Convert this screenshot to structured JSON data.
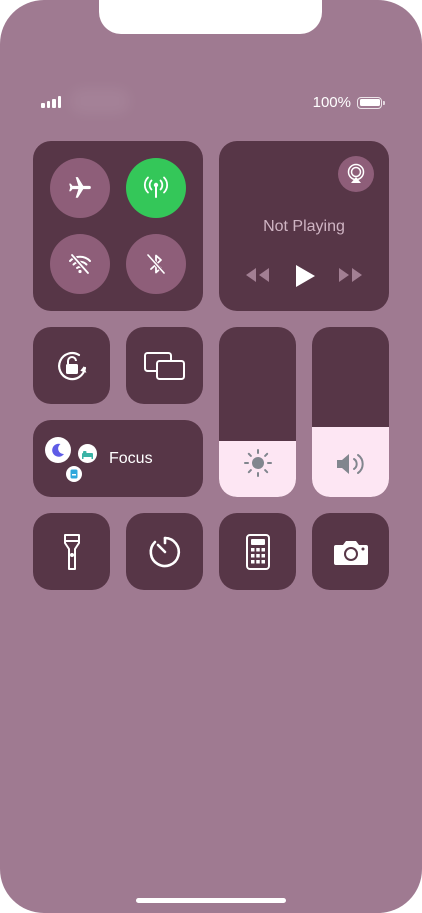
{
  "status_bar": {
    "battery_text": "100%",
    "battery_level": 1.0,
    "signal_bars": 4
  },
  "connectivity": {
    "airplane_icon": "airplane-icon",
    "cellular_icon": "cellular-antenna-icon",
    "wifi_icon": "wifi-off-icon",
    "bluetooth_icon": "bluetooth-off-icon",
    "cellular_on": true
  },
  "media": {
    "status": "Not Playing",
    "airplay_icon": "airplay-icon",
    "prev_icon": "rewind-icon",
    "play_icon": "play-icon",
    "next_icon": "fast-forward-icon"
  },
  "controls": {
    "rotation_lock_icon": "rotation-lock-icon",
    "screen_mirroring_icon": "screen-mirroring-icon"
  },
  "focus": {
    "label": "Focus",
    "icons": [
      "moon-icon",
      "bed-icon",
      "badge-icon"
    ]
  },
  "sliders": {
    "brightness_level": 0.33,
    "volume_level": 0.41
  },
  "bottom_row": {
    "flashlight": "flashlight-icon",
    "timer": "timer-icon",
    "calculator": "calculator-icon",
    "camera": "camera-icon"
  },
  "colors": {
    "background": "#9f7a91",
    "tile": "#573647",
    "button": "#8e5e79",
    "active_green": "#34c759",
    "slider_fill": "#fde6f3"
  }
}
